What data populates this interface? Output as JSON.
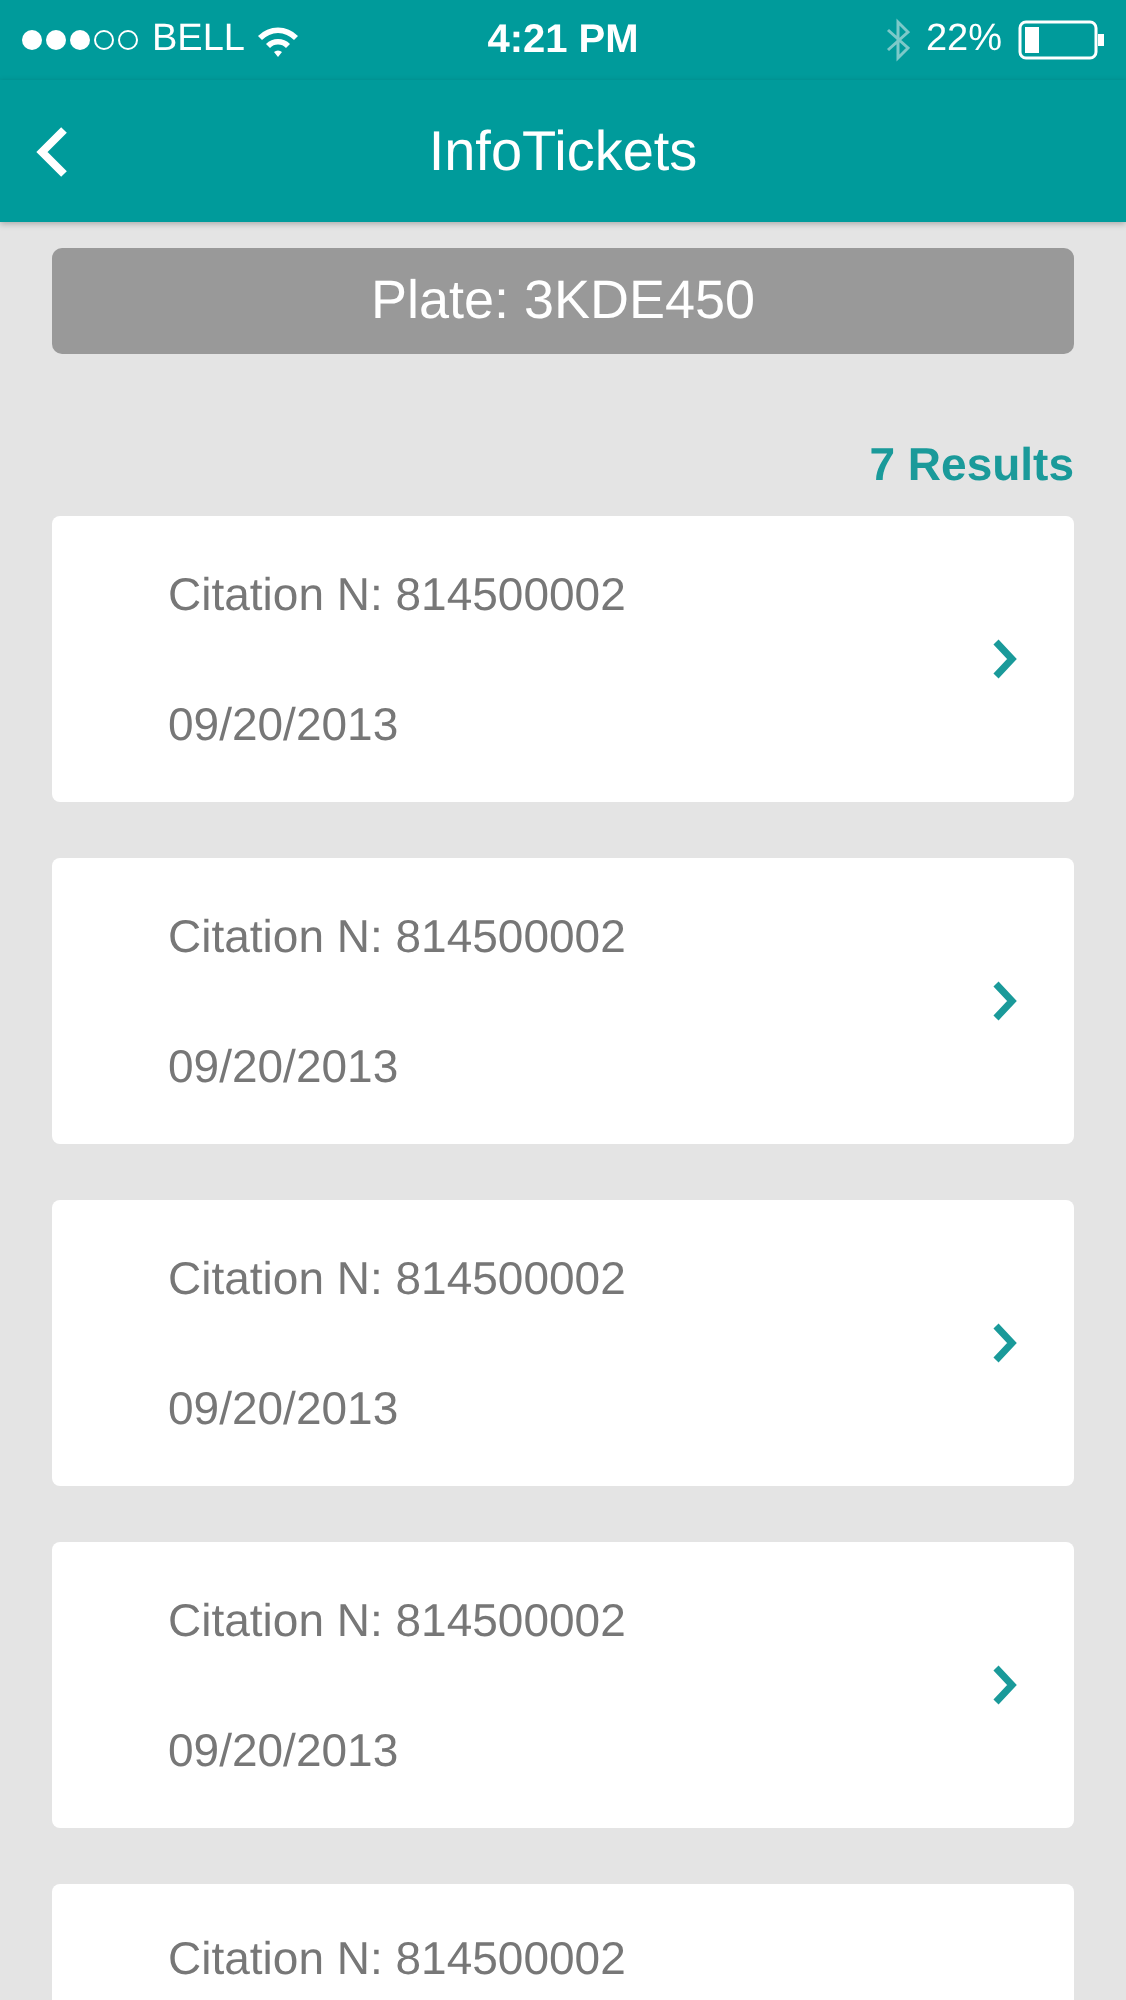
{
  "status_bar": {
    "carrier": "BELL",
    "time": "4:21 PM",
    "battery": "22%"
  },
  "nav": {
    "title": "InfoTickets"
  },
  "plate": "Plate: 3KDE450",
  "results": "7 Results",
  "tickets": [
    {
      "citation": "Citation N: 814500002",
      "date": "09/20/2013"
    },
    {
      "citation": "Citation N: 814500002",
      "date": "09/20/2013"
    },
    {
      "citation": "Citation N: 814500002",
      "date": "09/20/2013"
    },
    {
      "citation": "Citation N: 814500002",
      "date": "09/20/2013"
    },
    {
      "citation": "Citation N: 814500002"
    }
  ]
}
